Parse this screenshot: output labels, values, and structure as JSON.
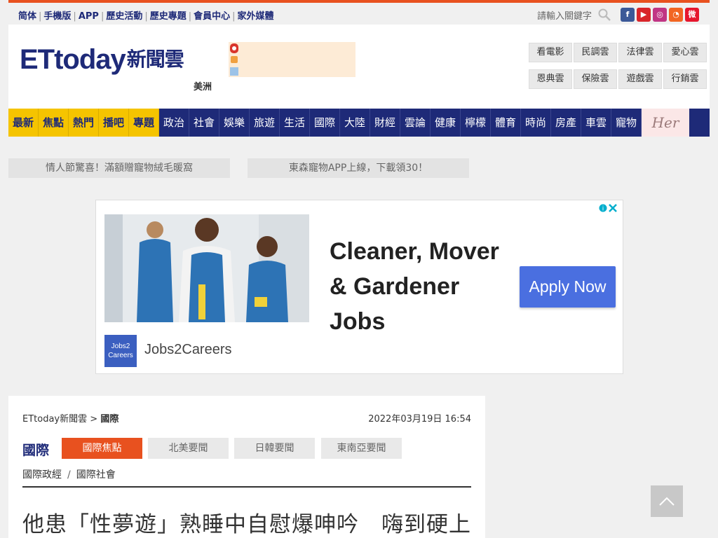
{
  "topbar": {
    "links": [
      "简体",
      "手機版",
      "APP",
      "歷史活動",
      "歷史專題",
      "會員中心",
      "家外媒體"
    ],
    "search_placeholder": "請輸入關鍵字",
    "social": [
      {
        "name": "facebook-icon",
        "glyph": "f",
        "color": "#3b5998"
      },
      {
        "name": "youtube-icon",
        "glyph": "▶",
        "color": "#d9252a"
      },
      {
        "name": "instagram-icon",
        "glyph": "◎",
        "color": "#c13584"
      },
      {
        "name": "rss-icon",
        "glyph": "◔",
        "color": "#f26522"
      },
      {
        "name": "weibo-icon",
        "glyph": "微",
        "color": "#e6162d"
      }
    ]
  },
  "header": {
    "logo_et": "ETtoday",
    "logo_cn": "新聞雲",
    "region": "美洲",
    "clouds": [
      "看電影",
      "民調雲",
      "法律雲",
      "愛心雲",
      "恩典雲",
      "保險雲",
      "遊戲雲",
      "行銷雲"
    ]
  },
  "nav": {
    "hot": [
      "最新",
      "焦點",
      "熱門",
      "播吧",
      "專題"
    ],
    "items": [
      "政治",
      "社會",
      "娛樂",
      "旅遊",
      "生活",
      "國際",
      "大陸",
      "財經",
      "雲論",
      "健康",
      "檸檬",
      "體育",
      "時尚",
      "房產",
      "車雲",
      "寵物"
    ],
    "her": "Her"
  },
  "promos": [
    "情人節驚喜！滿額贈寵物絨毛暖窩",
    "東森寵物APP上線，下載領30！"
  ],
  "ad": {
    "headline": "Cleaner, Mover & Gardener Jobs",
    "cta": "Apply Now",
    "brand": "Jobs2Careers",
    "logo_text": "Jobs2 Careers"
  },
  "article": {
    "breadcrumb_home": "ETtoday新聞雲",
    "breadcrumb_sep": ">",
    "breadcrumb_section": "國際",
    "date": "2022年03月19日 16:54",
    "category": "國際",
    "tabs": [
      "國際焦點",
      "北美要聞",
      "日韓要聞",
      "東南亞要聞"
    ],
    "subcats": [
      "國際政經",
      "國際社會"
    ],
    "headline": "他患「性夢遊」熟睡中自慰爆呻吟　嗨到硬上"
  }
}
